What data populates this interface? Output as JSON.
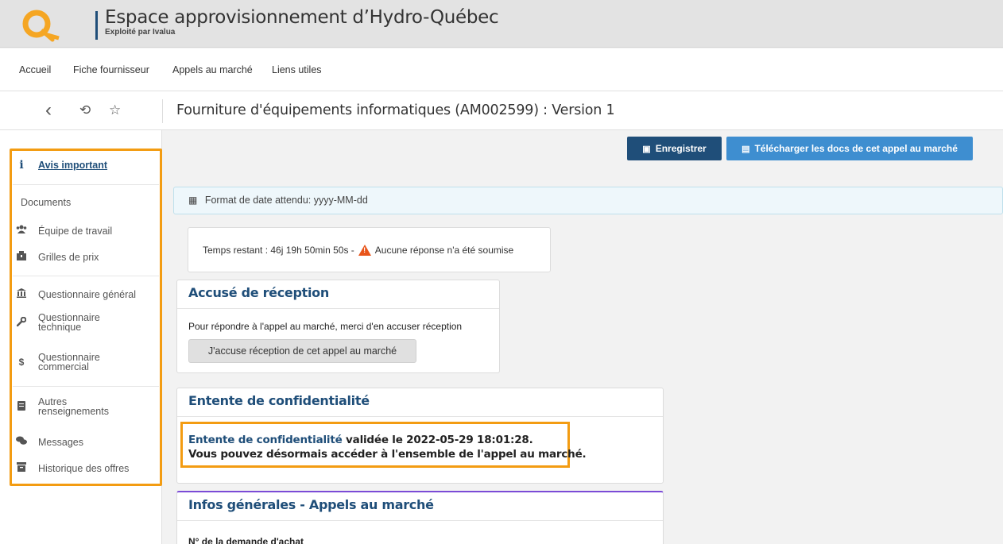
{
  "header": {
    "title": "Espace approvisionnement d’Hydro-Québec",
    "subtitle": "Exploité par Ivalua",
    "logo_letter": "Q"
  },
  "nav": {
    "items": [
      "Accueil",
      "Fiche fournisseur",
      "Appels au marché",
      "Liens utiles"
    ]
  },
  "toolbar": {
    "back_icon": "‹",
    "history_icon": "⟲",
    "star_icon": "☆",
    "page_title": "Fourniture d'équipements informatiques (AM002599) : Version 1"
  },
  "sidebar": {
    "important": {
      "icon": "i",
      "label": "Avis important"
    },
    "documents_label": "Documents",
    "items": [
      {
        "icon": "users-icon",
        "label": "Équipe de travail"
      },
      {
        "icon": "package-icon",
        "label": "Grilles de prix"
      },
      {
        "icon": "bank-icon",
        "label": "Questionnaire général"
      },
      {
        "icon": "wrench-icon",
        "label": "Questionnaire technique"
      },
      {
        "icon": "dollar-icon",
        "label": "Questionnaire commercial"
      },
      {
        "icon": "book-icon",
        "label": "Autres renseignements"
      },
      {
        "icon": "chat-icon",
        "label": "Messages"
      },
      {
        "icon": "archive-icon",
        "label": "Historique des offres"
      }
    ]
  },
  "actions": {
    "save_label": "Enregistrer",
    "download_label": "Télécharger les docs de cet appel au marché"
  },
  "date_banner": "Format de date attendu: yyyy-MM-dd",
  "timer": {
    "prefix": "Temps restant : ",
    "value": "46j 19h 50min 50s",
    "separator": " - ",
    "warning": "Aucune réponse n'a été soumise"
  },
  "ack_card": {
    "title": "Accusé de réception",
    "text": "Pour répondre à l'appel au marché, merci d'en accuser réception",
    "button": "J'accuse réception de cet appel au marché"
  },
  "conf_card": {
    "title": "Entente de confidentialité",
    "link": "Entente de confidentialité",
    "line1_rest": " validée le 2022-05-29 18:01:28.",
    "line2": "Vous pouvez désormais accéder à l'ensemble de l'appel au marché."
  },
  "info_card": {
    "title": "Infos générales - Appels au marché",
    "field_label": "N° de la demande d'achat"
  },
  "colors": {
    "brand_blue": "#1f4e79",
    "button_blue": "#3e8ed0",
    "highlight_orange": "#f39c12",
    "logo_orange": "#f5a623"
  }
}
